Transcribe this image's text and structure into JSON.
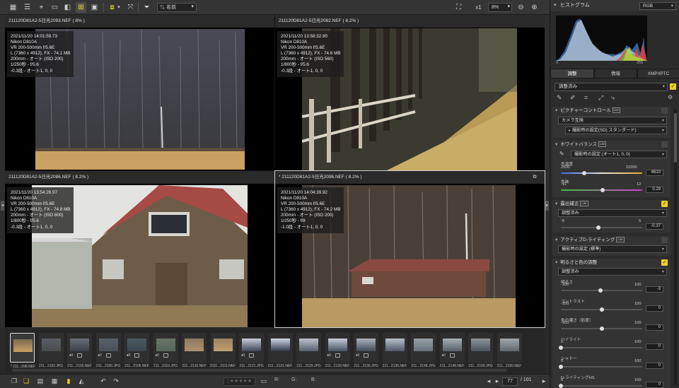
{
  "toolbar": {
    "sort_label": "名前",
    "zoom_mode": "x1",
    "zoom_value": "8%"
  },
  "panes": [
    {
      "title": "211120D81A2-5日光2093.NEF ( 8% )",
      "info": [
        "2021/11/20 14:01:59.73",
        "Nikon D810A",
        "VR 200-500mm f/5.6E",
        "L (7360 x 4912), FX - 74.1 MB",
        "200mm - オート (ISO 200)",
        "1/250秒 - f/5.6",
        "-0.3段 - オート1, 0, 0"
      ]
    },
    {
      "title": "211120D81A2-5日光2082.NEF ( 8.2% )",
      "info": [
        "2021/11/20 13:58:32.90",
        "Nikon D810A",
        "VR 200-500mm f/5.6E",
        "L (7360 x 4912), FX - 74.6 MB",
        "200mm - オート (ISO 560)",
        "1/800秒 - f/5.6",
        "-0.3段 - オート1, 0, 0"
      ]
    },
    {
      "title": "211120D81A2-5日光2086.NEF ( 8.2% )",
      "info": [
        "2021/11/20 13:54:26.97",
        "Nikon D810A",
        "VR 200-500mm f/5.6E",
        "L (7360 x 4912), FX - 74.8 MB",
        "200mm - オート (ISO 800)",
        "1/800秒 - f/5.6",
        "-0.3段 - オート1, 0, 0"
      ]
    },
    {
      "title": "* 211120D81A2-5日光2096.NEF ( 8.2% )",
      "info": [
        "2021/11/20 14:04:39.92",
        "Nikon D810A",
        "VR 200-500mm f/5.6E",
        "L (7360 x 4912), FX - 74.2 MB",
        "200mm - オート (ISO 200)",
        "1/250秒 - f/8",
        "-1.0段 - オート1, 0, 0"
      ]
    }
  ],
  "filmstrip": [
    {
      "cap": "* 211...098.NEF",
      "mark": ""
    },
    {
      "cap": "211...2103.JPG",
      "mark": ""
    },
    {
      "cap": "211...2103.NEF",
      "mark": "♦0"
    },
    {
      "cap": "211...2106.JPG",
      "mark": "♦0"
    },
    {
      "cap": "211...2106.NEF",
      "mark": "♦0"
    },
    {
      "cap": "211...2110.JPG",
      "mark": "♦0"
    },
    {
      "cap": "211...2110.NEF",
      "mark": ""
    },
    {
      "cap": "2111...2111.NEF",
      "mark": ""
    },
    {
      "cap": "211...2121.JPG",
      "mark": "♦0"
    },
    {
      "cap": "211...2121.NEF",
      "mark": ""
    },
    {
      "cap": "211...2129.JPG",
      "mark": ""
    },
    {
      "cap": "211...2129.NEF",
      "mark": "♦0"
    },
    {
      "cap": "211...2136.JPG",
      "mark": "♦0"
    },
    {
      "cap": "211...2136.NEF",
      "mark": ""
    },
    {
      "cap": "211...2148.JPG",
      "mark": ""
    },
    {
      "cap": "211...2148.NEF",
      "mark": "♦0"
    },
    {
      "cap": "211...2150.JPG",
      "mark": ""
    },
    {
      "cap": "211...2150.NEF",
      "mark": ""
    }
  ],
  "bottombar": {
    "r_label": "R:",
    "g_label": "G:",
    "b_label": "B:",
    "page": "77",
    "total": "/ 101"
  },
  "right": {
    "histogram_title": "ヒストグラム",
    "channel": "RGB",
    "hist_min": "0",
    "hist_max": "255",
    "tabs": [
      "調整",
      "情報",
      "XMP/IPTC"
    ],
    "adjusted": "調整済み",
    "picture_control": {
      "title": "ピクチャーコントロール",
      "tag": "Lite",
      "mode": "カメラ互換",
      "setting": "撮影時の設定(SD) スタンダード)"
    },
    "white_balance": {
      "title": "ホワイトバランス",
      "tag": "Lite",
      "setting": "撮影時の設定 (オート1, 0, 0)",
      "temp_label": "色温度",
      "temp_min": "2500",
      "temp_max": "10000",
      "temp_val": "4610",
      "tint_label": "色味",
      "tint_min": "-12",
      "tint_max": "12",
      "tint_val": "0.29",
      "temp_pos": 0.29,
      "tint_pos": 0.51
    },
    "exposure": {
      "title": "露出補正",
      "tag": "Lite",
      "state": "調整済み",
      "min": "-5",
      "max": "5",
      "val": "-0.37",
      "pos": 0.46
    },
    "adl": {
      "title": "アクティブD-ライティング",
      "tag": "Lite",
      "setting": "撮影時の設定 (標準)"
    },
    "brightness": {
      "title": "明るさと色の調整",
      "state": "調整済み",
      "rows": [
        {
          "label": "明るさ",
          "min": "-100",
          "max": "100",
          "val": "-3",
          "pos": 0.49
        },
        {
          "label": "コントラスト",
          "min": "-100",
          "max": "100",
          "val": "0",
          "pos": 0.5
        },
        {
          "label": "色の濃さ（彩度）",
          "min": "-100",
          "max": "100",
          "val": "0",
          "pos": 0.5
        },
        {
          "label": "ハイライト",
          "min": "0",
          "max": "100",
          "val": "0",
          "pos": 0.0
        },
        {
          "label": "シャドー",
          "min": "0",
          "max": "100",
          "val": "0",
          "pos": 0.0
        },
        {
          "label": "D-ライティングHS",
          "min": "0",
          "max": "100",
          "val": "0",
          "pos": 0.0
        }
      ]
    }
  }
}
